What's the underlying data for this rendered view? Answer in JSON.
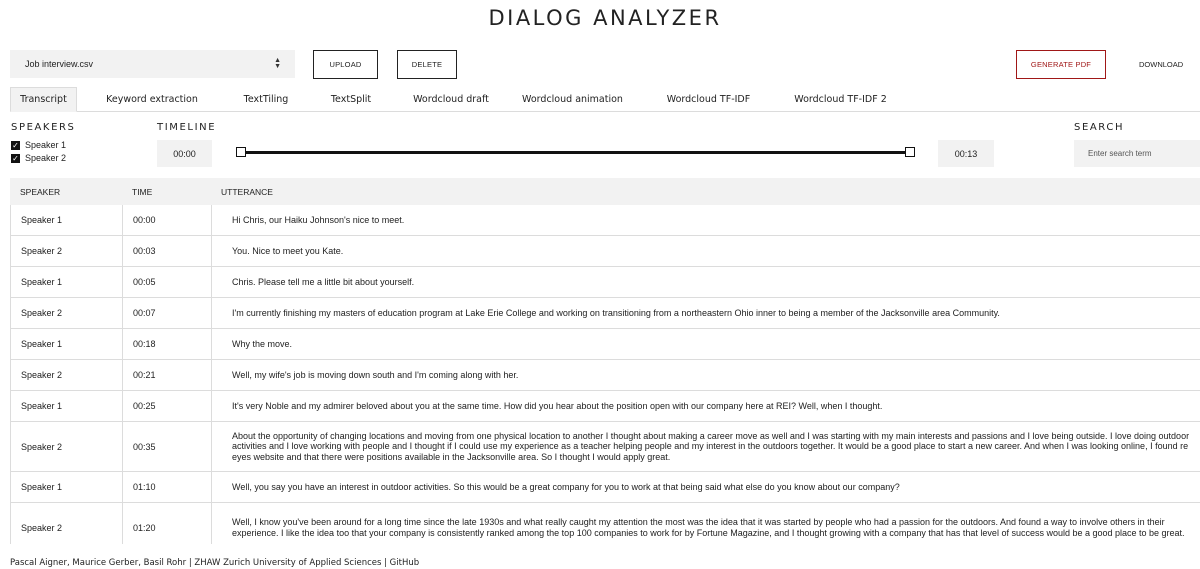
{
  "app": {
    "title": "DIALOG ANALYZER"
  },
  "toolbar": {
    "file_select_value": "Job interview.csv",
    "upload_label": "UPLOAD",
    "delete_label": "DELETE",
    "generate_pdf_label": "GENERATE PDF",
    "download_label": "DOWNLOAD"
  },
  "tabs": [
    {
      "label": "Transcript",
      "active": true
    },
    {
      "label": "Keyword extraction",
      "active": false
    },
    {
      "label": "TextTiling",
      "active": false
    },
    {
      "label": "TextSplit",
      "active": false
    },
    {
      "label": "Wordcloud draft",
      "active": false
    },
    {
      "label": "Wordcloud animation",
      "active": false
    },
    {
      "label": "Wordcloud TF-IDF",
      "active": false
    },
    {
      "label": "Wordcloud TF-IDF 2",
      "active": false
    }
  ],
  "speakers": {
    "title": "SPEAKERS",
    "items": [
      {
        "label": "Speaker 1",
        "checked": true
      },
      {
        "label": "Speaker 2",
        "checked": true
      }
    ]
  },
  "timeline": {
    "title": "TIMELINE",
    "start": "00:00",
    "end": "00:13"
  },
  "search": {
    "title": "SEARCH",
    "placeholder": "Enter search term"
  },
  "table": {
    "headers": {
      "speaker": "SPEAKER",
      "time": "TIME",
      "utterance": "UTTERANCE"
    },
    "rows": [
      {
        "speaker": "Speaker 1",
        "time": "00:00",
        "utterance": "Hi Chris, our Haiku Johnson's nice to meet."
      },
      {
        "speaker": "Speaker 2",
        "time": "00:03",
        "utterance": "You. Nice to meet you Kate."
      },
      {
        "speaker": "Speaker 1",
        "time": "00:05",
        "utterance": "Chris. Please tell me a little bit about yourself."
      },
      {
        "speaker": "Speaker 2",
        "time": "00:07",
        "utterance": "I'm currently finishing my masters of education program at Lake Erie College and working on transitioning from a northeastern Ohio inner to being a member of the Jacksonville area Community."
      },
      {
        "speaker": "Speaker 1",
        "time": "00:18",
        "utterance": "Why the move."
      },
      {
        "speaker": "Speaker 2",
        "time": "00:21",
        "utterance": "Well, my wife's job is moving down south and I'm coming along with her."
      },
      {
        "speaker": "Speaker 1",
        "time": "00:25",
        "utterance": "It's very Noble and my admirer beloved about you at the same time. How did you hear about the position open with our company here at REI? Well, when I thought."
      },
      {
        "speaker": "Speaker 2",
        "time": "00:35",
        "utterance": "About the opportunity of changing locations and moving from one physical location to another I thought about making a career move as well and I was starting with my main interests and passions and I love being outside. I love doing outdoor activities and I love working with people and I thought if I could use my experience as a teacher helping people and my interest in the outdoors together. It would be a good place to start a new career. And when I was looking online, I found re eyes website and that there were positions available in the Jacksonville area. So I thought I would apply great."
      },
      {
        "speaker": "Speaker 1",
        "time": "01:10",
        "utterance": "Well, you say you have an interest in outdoor activities. So this would be a great company for you to work at that being said what else do you know about our company?"
      },
      {
        "speaker": "Speaker 2",
        "time": "01:20",
        "utterance": "Well, I know you've been around for a long time since the late 1930s and what really caught my attention the most was the idea that it was started by people who had a passion for the outdoors. And found a way to involve others in their experience. I like the idea too that your company is consistently ranked among the top 100 companies to work for by Fortune Magazine, and I thought growing with a company that has that level of success would be a good place to be great."
      }
    ]
  },
  "footer": {
    "text": "Pascal Aigner, Maurice Gerber, Basil Rohr | ZHAW Zurich University of Applied Sciences | GitHub"
  },
  "colors": {
    "accent": "#a01717",
    "panel": "#f2f2f2",
    "border": "#dcdcdc"
  }
}
